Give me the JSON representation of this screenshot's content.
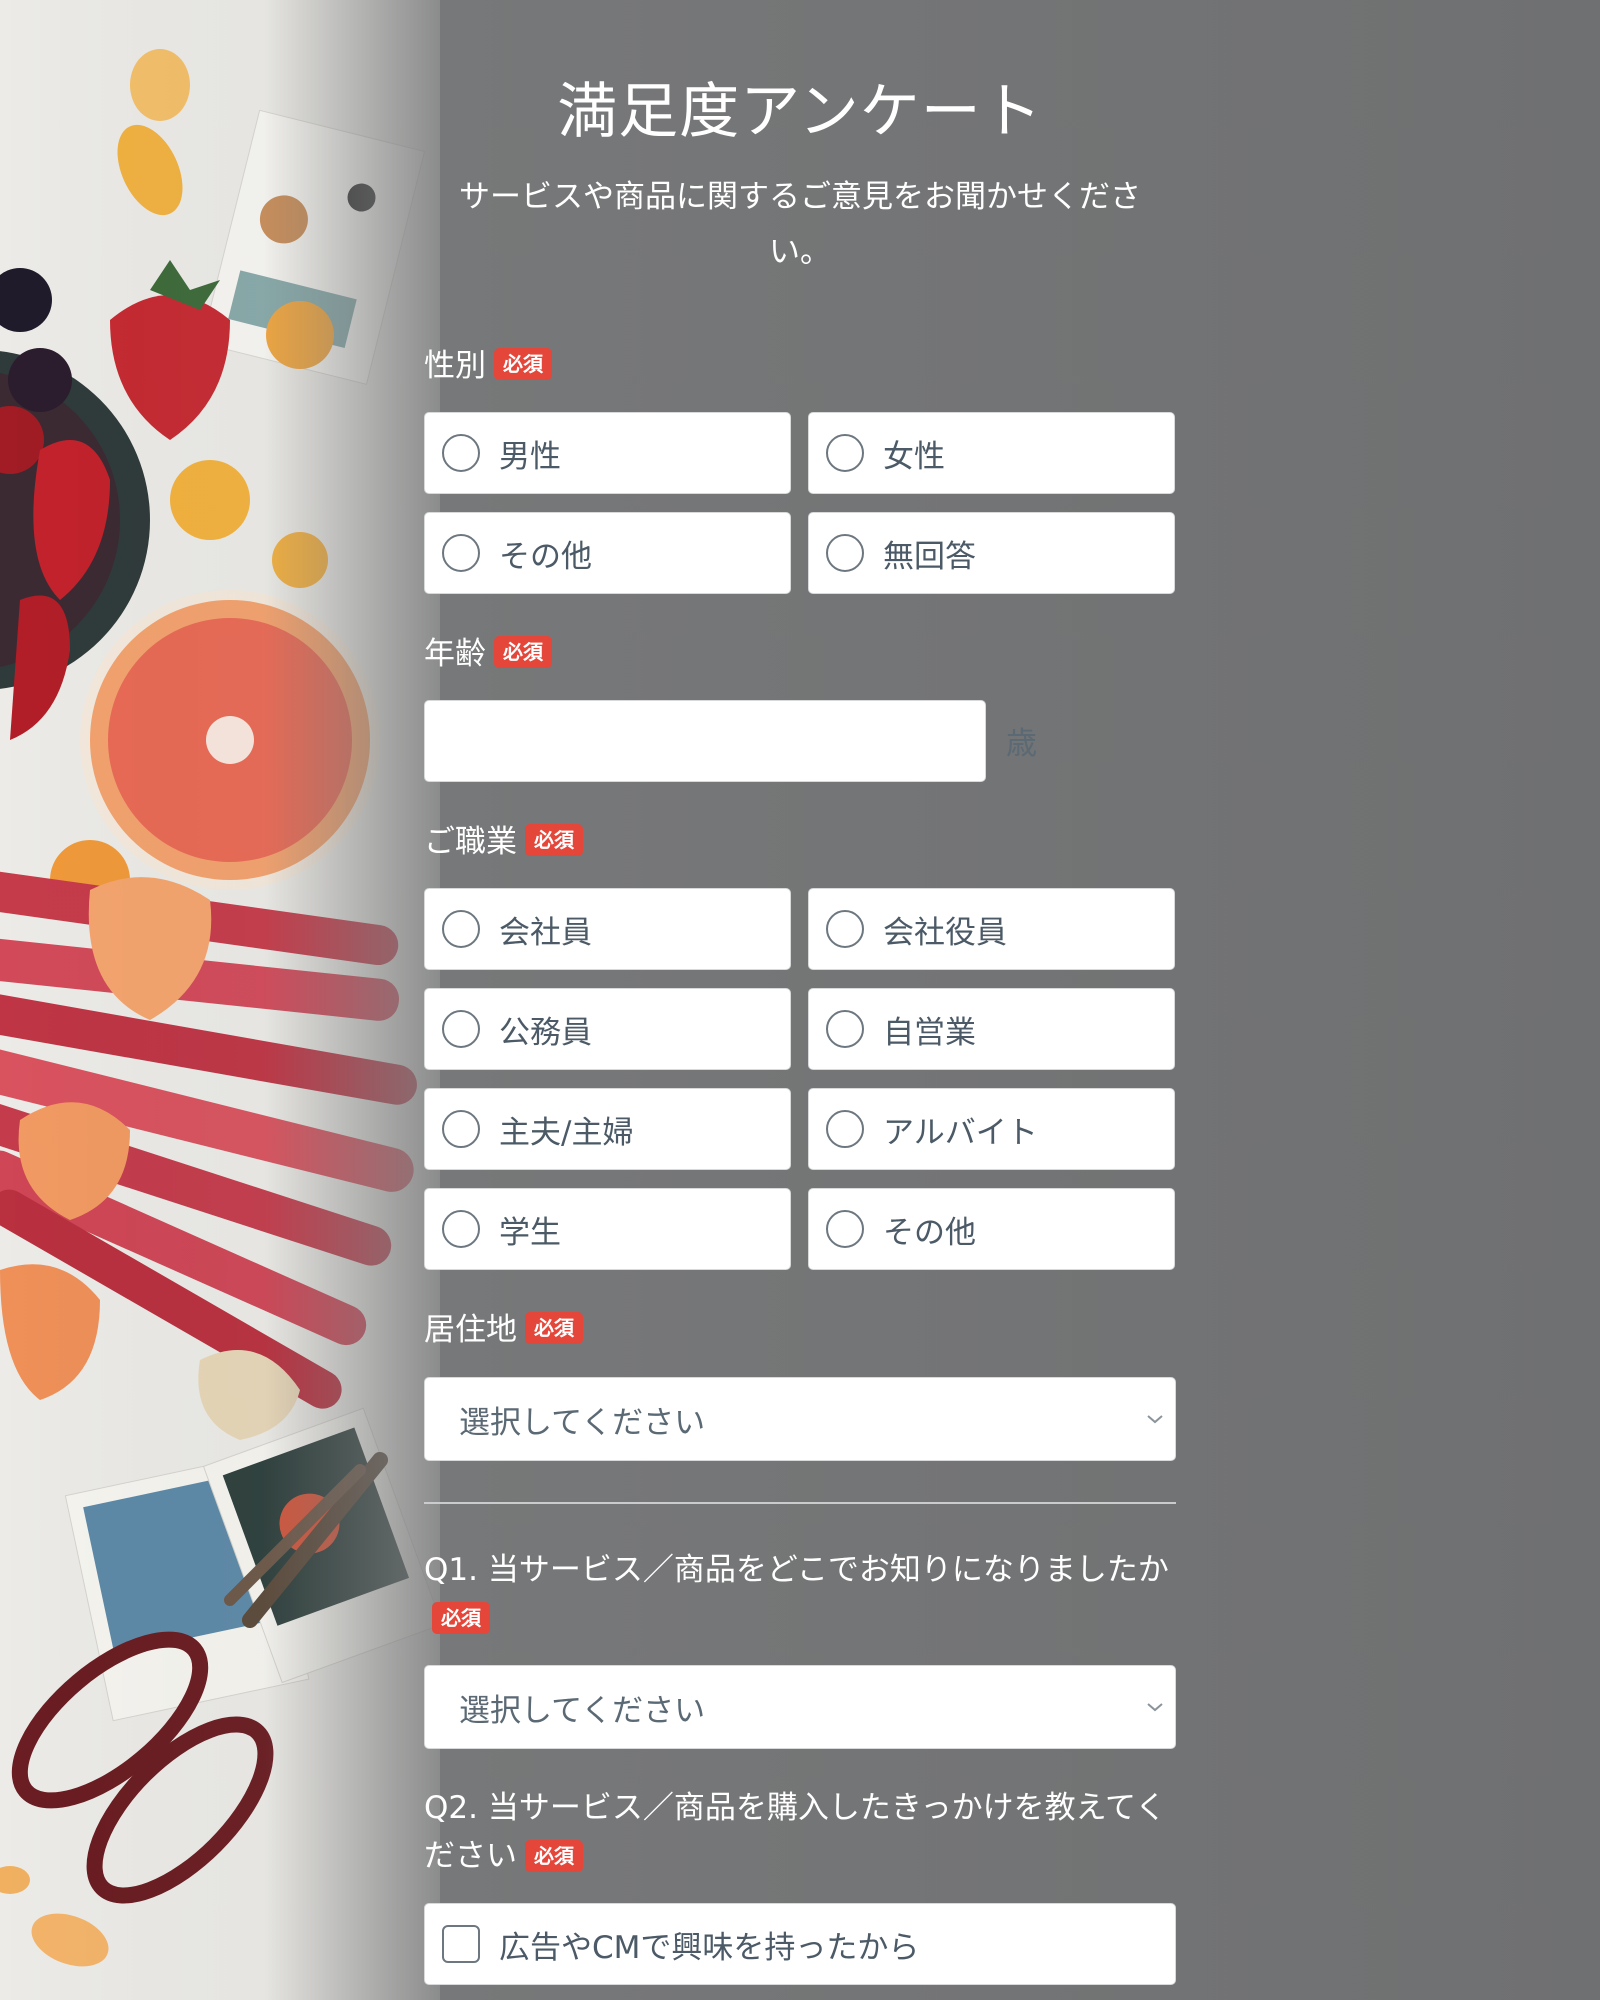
{
  "header": {
    "title": "満足度アンケート",
    "subtitle": "サービスや商品に関するご意見をお聞かせください。"
  },
  "required_label": "必須",
  "gender": {
    "label": "性別",
    "options": [
      "男性",
      "女性",
      "その他",
      "無回答"
    ]
  },
  "age": {
    "label": "年齢",
    "value": "",
    "unit": "歳"
  },
  "occupation": {
    "label": "ご職業",
    "options": [
      "会社員",
      "会社役員",
      "公務員",
      "自営業",
      "主夫/主婦",
      "アルバイト",
      "学生",
      "その他"
    ]
  },
  "residence": {
    "label": "居住地",
    "placeholder": "選択してください"
  },
  "q1": {
    "label": "Q1. 当サービス／商品をどこでお知りになりましたか",
    "placeholder": "選択してください"
  },
  "q2": {
    "label": "Q2. 当サービス／商品を購入したきっかけを教えてください",
    "options": [
      "広告やCMで興味を持ったから"
    ]
  },
  "colors": {
    "background": "#737475",
    "badge": "#e4463a",
    "input_bg": "#ffffff",
    "option_text": "#4b5a66"
  },
  "icons": {
    "radio": "radio-button-icon",
    "checkbox": "checkbox-icon",
    "select": "chevron-down-icon"
  }
}
